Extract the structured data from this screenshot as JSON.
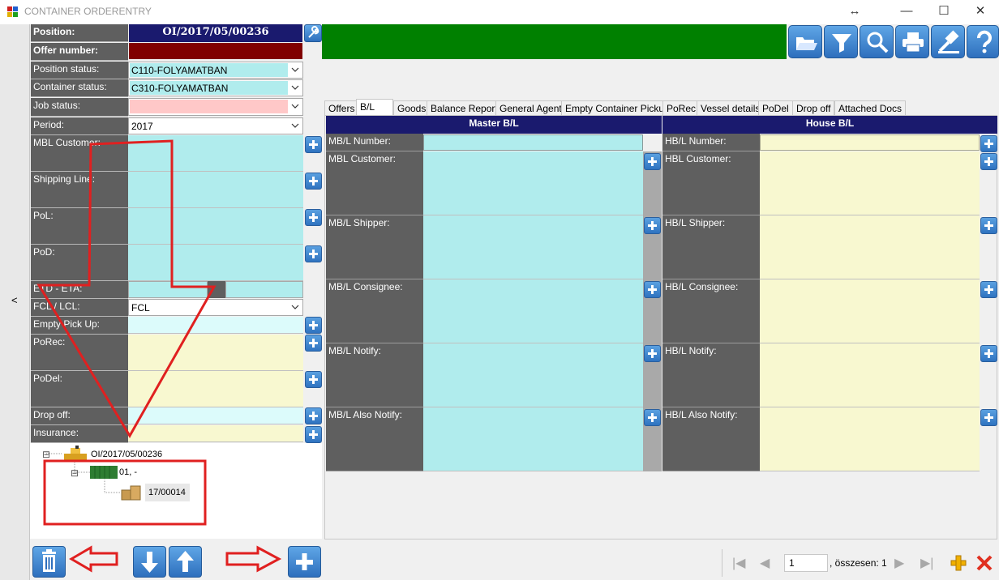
{
  "window": {
    "title": "CONTAINER ORDERENTRY",
    "resize_glyph": "↔",
    "minimize": "—",
    "maximize": "☐",
    "close": "✕"
  },
  "collapse_glyph": "<",
  "left_form": {
    "position_label": "Position:",
    "position_value": "OI/2017/05/00236",
    "offer_label": "Offer number:",
    "position_status_label": "Position status:",
    "position_status_value": "C110-FOLYAMATBAN",
    "container_status_label": "Container status:",
    "container_status_value": "C310-FOLYAMATBAN",
    "job_status_label": "Job status:",
    "job_status_value": "",
    "period_label": "Period:",
    "period_value": "2017",
    "mbl_customer_label": "MBL Customer:",
    "shipping_line_label": "Shipping Line:",
    "pol_label": "PoL:",
    "pod_label": "PoD:",
    "etd_eta_label": "ETD - ETA:",
    "fcl_lcl_label": "FCL / LCL:",
    "fcl_lcl_value": "FCL",
    "empty_pickup_label": "Empty Pick Up:",
    "porec_label": "PoRec:",
    "podel_label": "PoDel:",
    "drop_off_label": "Drop off:",
    "insurance_label": "Insurance:"
  },
  "toolbar": {
    "icons": [
      "open-folder-icon",
      "filter-icon",
      "search-icon",
      "print-icon",
      "gavel-icon",
      "help-icon"
    ]
  },
  "tabs": [
    "Offers",
    "B/L",
    "Goods",
    "Balance Report",
    "General Agent",
    "Empty Container Pickup",
    "PoRec",
    "Vessel details",
    "PoDel",
    "Drop off",
    "Attached Docs"
  ],
  "active_tab": "B/L",
  "bl": {
    "master_header": "Master B/L",
    "house_header": "House B/L",
    "master_rows": [
      "MB/L Number:",
      "MBL Customer:",
      "MB/L Shipper:",
      "MB/L Consignee:",
      "MB/L Notify:",
      "MB/L Also Notify:"
    ],
    "house_rows": [
      "HB/L Number:",
      "HBL Customer:",
      "HB/L Shipper:",
      "HB/L Consignee:",
      "HB/L Notify:",
      "HB/L Also Notify:"
    ]
  },
  "tree": {
    "root": "OI/2017/05/00236",
    "container": "01,  -",
    "item": "17/00014",
    "expander": "⊟"
  },
  "navigator": {
    "page": "1",
    "total_text": ", összesen: 1"
  },
  "colors": {
    "label_bg": "#5f5f5f",
    "cyan_field": "#b0eced",
    "yellow_field": "#f8f8d0",
    "navy_header": "#1a1a6e",
    "offer_red": "#800000",
    "green_banner": "#008000",
    "annotation_red": "#e02020"
  }
}
